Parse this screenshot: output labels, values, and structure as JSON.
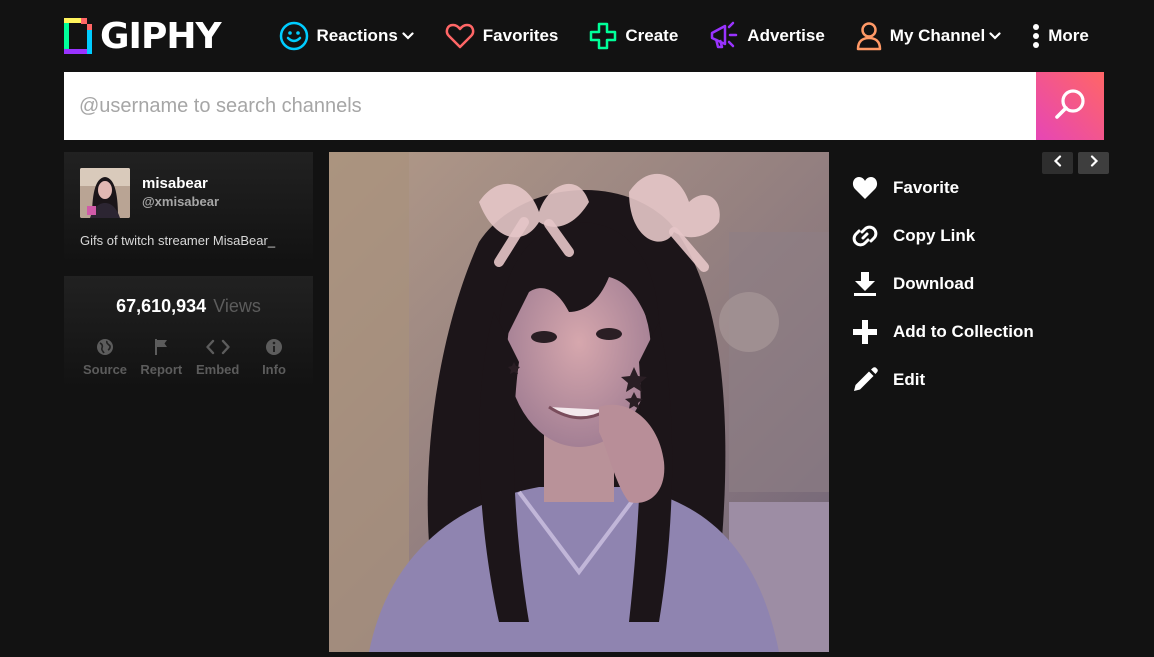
{
  "header": {
    "logo_text": "GIPHY",
    "nav": {
      "reactions": "Reactions",
      "favorites": "Favorites",
      "create": "Create",
      "advertise": "Advertise",
      "my_channel": "My Channel",
      "more": "More"
    }
  },
  "search": {
    "placeholder": "@username to search channels",
    "value": ""
  },
  "user": {
    "name": "misabear",
    "handle": "@xmisabear",
    "description": "Gifs of twitch streamer MisaBear_"
  },
  "stats": {
    "views_count": "67,610,934",
    "views_label": "Views",
    "tools": {
      "source": "Source",
      "report": "Report",
      "embed": "Embed",
      "info": "Info"
    }
  },
  "actions": {
    "favorite": "Favorite",
    "copy_link": "Copy Link",
    "download": "Download",
    "add_to_collection": "Add to Collection",
    "edit": "Edit"
  },
  "icons": {
    "reactions": "smiley-icon",
    "favorites": "heart-outline-icon",
    "create": "plus-outline-icon",
    "advertise": "megaphone-icon",
    "my_channel": "user-icon",
    "more": "vertical-dots-icon"
  },
  "colors": {
    "background": "#121212",
    "reactions": "#00ccff",
    "favorites": "#ff6666",
    "create": "#00ff99",
    "advertise": "#9933ff",
    "my_channel": "#ff9966",
    "search_gradient_start": "#e646b6",
    "search_gradient_end": "#ff6666"
  }
}
